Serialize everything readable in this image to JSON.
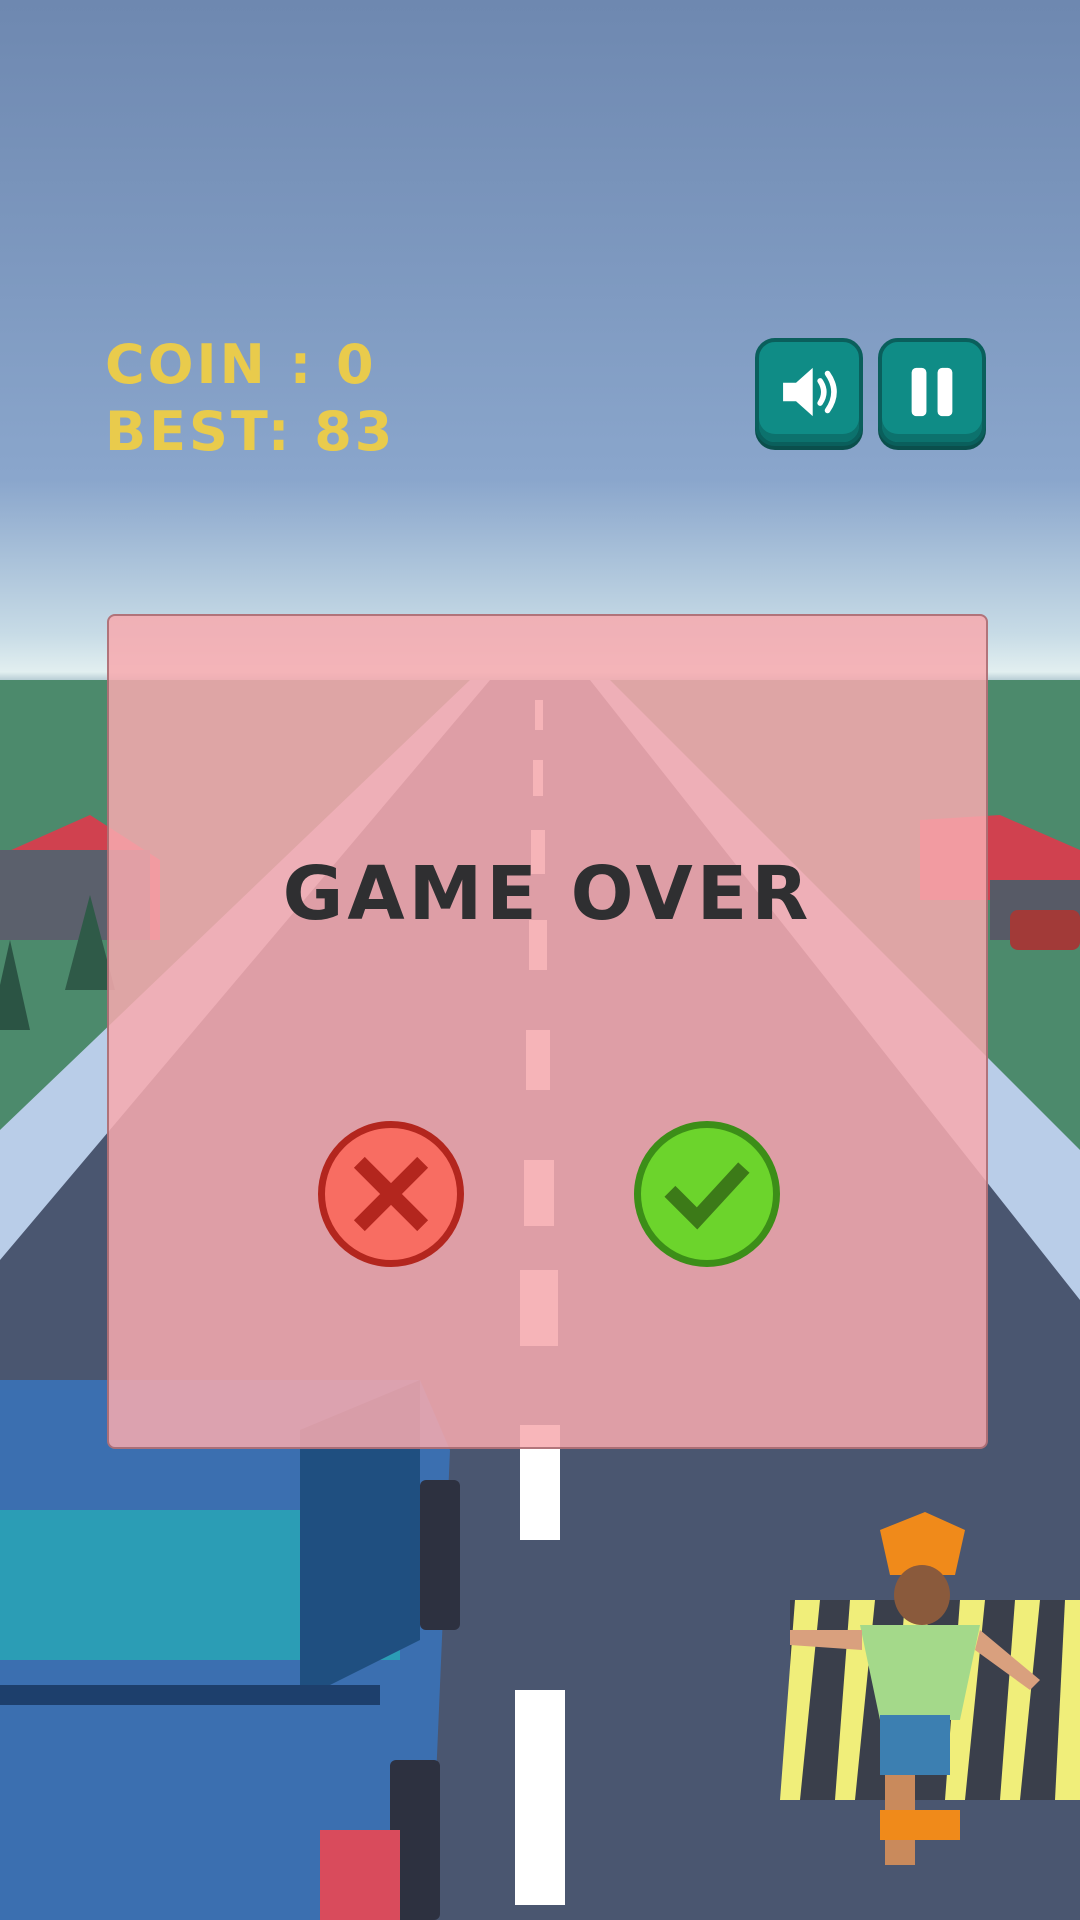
{
  "hud": {
    "coin_text": "COIN : 0",
    "best_text": "BEST: 83",
    "sound_icon": "speaker-icon",
    "pause_icon": "pause-icon"
  },
  "game_over": {
    "title": "GAME OVER",
    "quit_icon": "close-icon",
    "retry_icon": "check-icon"
  },
  "colors": {
    "hud_text": "#e9cb4c",
    "hud_button": "#0f8c86",
    "panel": "#f7aaaf",
    "quit_button": "#f86d62",
    "retry_button": "#6cd42c"
  }
}
